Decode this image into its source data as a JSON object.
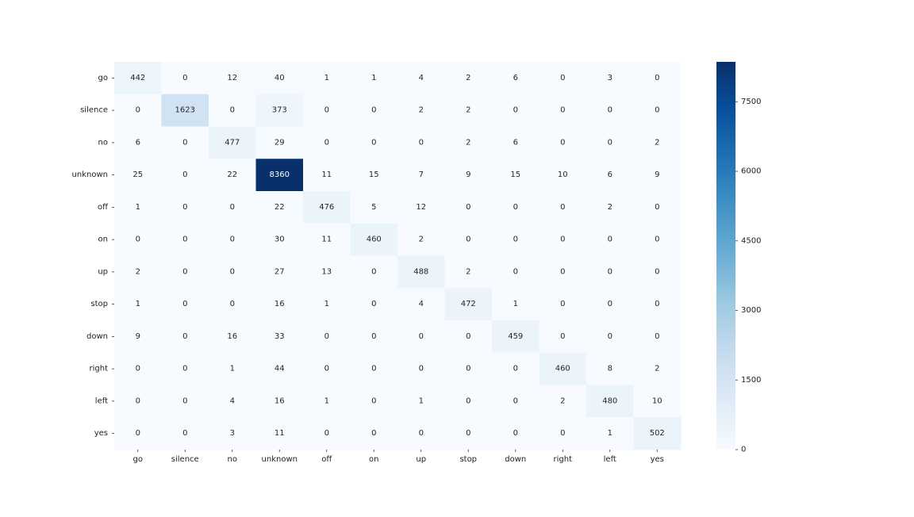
{
  "chart_data": {
    "type": "heatmap",
    "title": "",
    "xlabel": "",
    "ylabel": "",
    "x_labels": [
      "go",
      "silence",
      "no",
      "unknown",
      "off",
      "on",
      "up",
      "stop",
      "down",
      "right",
      "left",
      "yes"
    ],
    "y_labels": [
      "go",
      "silence",
      "no",
      "unknown",
      "off",
      "on",
      "up",
      "stop",
      "down",
      "right",
      "left",
      "yes"
    ],
    "matrix": [
      [
        442,
        0,
        12,
        40,
        1,
        1,
        4,
        2,
        6,
        0,
        3,
        0
      ],
      [
        0,
        1623,
        0,
        373,
        0,
        0,
        2,
        2,
        0,
        0,
        0,
        0
      ],
      [
        6,
        0,
        477,
        29,
        0,
        0,
        0,
        2,
        6,
        0,
        0,
        2
      ],
      [
        25,
        0,
        22,
        8360,
        11,
        15,
        7,
        9,
        15,
        10,
        6,
        9
      ],
      [
        1,
        0,
        0,
        22,
        476,
        5,
        12,
        0,
        0,
        0,
        2,
        0
      ],
      [
        0,
        0,
        0,
        30,
        11,
        460,
        2,
        0,
        0,
        0,
        0,
        0
      ],
      [
        2,
        0,
        0,
        27,
        13,
        0,
        488,
        2,
        0,
        0,
        0,
        0
      ],
      [
        1,
        0,
        0,
        16,
        1,
        0,
        4,
        472,
        1,
        0,
        0,
        0
      ],
      [
        9,
        0,
        16,
        33,
        0,
        0,
        0,
        0,
        459,
        0,
        0,
        0
      ],
      [
        0,
        0,
        1,
        44,
        0,
        0,
        0,
        0,
        0,
        460,
        8,
        2
      ],
      [
        0,
        0,
        4,
        16,
        1,
        0,
        1,
        0,
        0,
        2,
        480,
        10
      ],
      [
        0,
        0,
        3,
        11,
        0,
        0,
        0,
        0,
        0,
        0,
        1,
        502
      ]
    ],
    "colormap": "Blues",
    "colorbar": {
      "min": 0,
      "max": 8360,
      "ticks": [
        0,
        1500,
        3000,
        4500,
        6000,
        7500
      ],
      "tick_labels": [
        "0",
        "1500",
        "3000",
        "4500",
        "6000",
        "7500"
      ]
    },
    "legend": "colorbar-right",
    "grid": false
  }
}
